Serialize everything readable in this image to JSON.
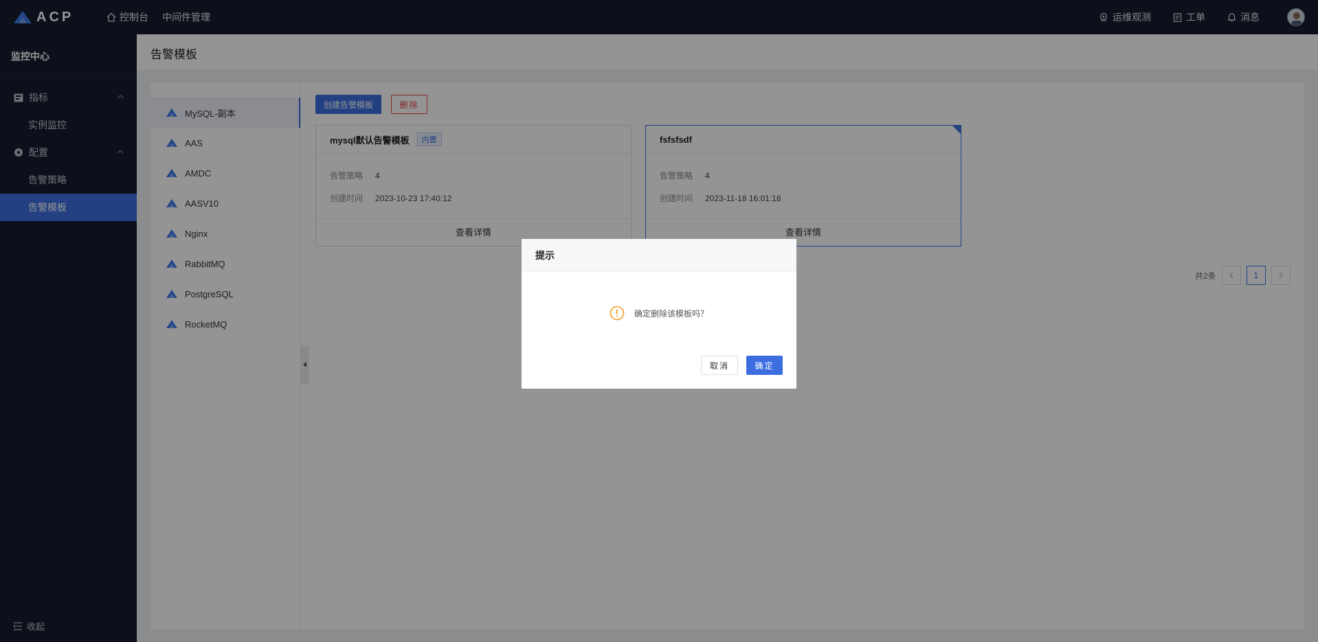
{
  "app": {
    "logo_text": "ACP"
  },
  "top_nav": [
    {
      "label": "控制台",
      "icon": "home-icon"
    },
    {
      "label": "中间件管理"
    }
  ],
  "top_right": [
    {
      "label": "运维观测",
      "icon": "location-icon"
    },
    {
      "label": "工单",
      "icon": "clipboard-icon"
    },
    {
      "label": "消息",
      "icon": "bell-icon"
    }
  ],
  "sidebar": {
    "title": "监控中心",
    "groups": [
      {
        "label": "指标",
        "icon": "metrics-icon",
        "items": [
          "实例监控"
        ]
      },
      {
        "label": "配置",
        "icon": "settings-icon",
        "items": [
          "告警策略",
          "告警模板"
        ]
      }
    ],
    "active_item": "告警模板",
    "collapse_label": "收起"
  },
  "page": {
    "title": "告警模板"
  },
  "middleware_list": [
    "MySQL-副本",
    "AAS",
    "AMDC",
    "AASV10",
    "Nginx",
    "RabbitMQ",
    "PostgreSQL",
    "RocketMQ"
  ],
  "toolbar": {
    "create_label": "创建告警模板",
    "delete_label": "删除"
  },
  "cards": [
    {
      "name": "mysql默认告警模板",
      "tag": "内置",
      "strategy_label": "告警策略",
      "strategy_value": "4",
      "time_label": "创建时间",
      "time_value": "2023-10-23 17:40:12",
      "detail_label": "查看详情"
    },
    {
      "name": "fsfsfsdf",
      "tag": "",
      "strategy_label": "告警策略",
      "strategy_value": "4",
      "time_label": "创建时间",
      "time_value": "2023-11-18 16:01:18",
      "detail_label": "查看详情"
    }
  ],
  "pagination": {
    "total_text": "共2条",
    "current_page": "1"
  },
  "modal": {
    "title": "提示",
    "message": "确定删除该模板吗？",
    "cancel_label": "取消",
    "ok_label": "确定"
  },
  "colors": {
    "primary": "#3c6ee0",
    "nav_bg": "#141c2e",
    "danger": "#e64545",
    "warning": "#f0a020"
  }
}
